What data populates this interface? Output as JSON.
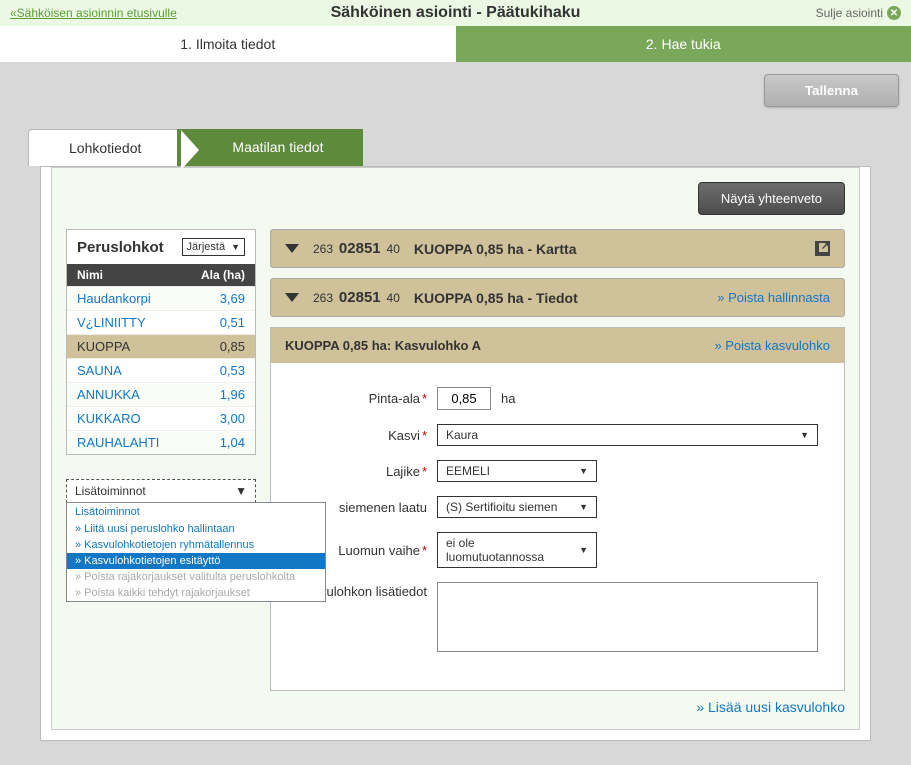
{
  "topbar": {
    "home_link": "«Sähköisen asioinnin etusivulle",
    "title": "Sähköinen asiointi  -  Päätukihaku",
    "close": "Sulje asiointi"
  },
  "steps": {
    "step1": "1. Ilmoita tiedot",
    "step2": "2. Hae tukia"
  },
  "toolbar": {
    "save": "Tallenna"
  },
  "tabs": {
    "tab1": "Lohkotiedot",
    "tab2": "Maatilan tiedot"
  },
  "summary_btn": "Näytä yhteenveto",
  "sidebar": {
    "title": "Peruslohkot",
    "sort_label": "Järjestä",
    "col_name": "Nimi",
    "col_area": "Ala (ha)",
    "rows": [
      {
        "name": "Haudankorpi",
        "area": "3,69"
      },
      {
        "name": "V¿LINIITTY",
        "area": "0,51"
      },
      {
        "name": "KUOPPA",
        "area": "0,85"
      },
      {
        "name": "SAUNA",
        "area": "0,53"
      },
      {
        "name": "ANNUKKA",
        "area": "1,96"
      },
      {
        "name": "KUKKARO",
        "area": "3,00"
      },
      {
        "name": "RAUHALAHTI",
        "area": "1,04"
      }
    ],
    "actions_label": "Lisätoiminnot",
    "menu": {
      "heading": "Lisätoiminnot",
      "items": [
        "» Liitä uusi peruslohko hallintaan",
        "» Kasvulohkotietojen ryhmätallennus",
        "» Kasvulohkotietojen esitäyttö",
        "» Poista rajakorjaukset valitulta peruslohkolta",
        "» Poista kaikki tehdyt rajakorjaukset"
      ]
    }
  },
  "block1": {
    "id_s1": "263",
    "id_b": "02851",
    "id_s2": "40",
    "title": "KUOPPA 0,85 ha - Kartta"
  },
  "block2": {
    "id_s1": "263",
    "id_b": "02851",
    "id_s2": "40",
    "title": "KUOPPA 0,85 ha - Tiedot",
    "link": "» Poista hallinnasta"
  },
  "growth": {
    "title": "KUOPPA 0,85 ha: Kasvulohko A",
    "remove": "» Poista kasvulohko"
  },
  "form": {
    "area_label": "Pinta-ala",
    "area_value": "0,85",
    "area_unit": "ha",
    "plant_label": "Kasvi",
    "plant_value": "Kaura",
    "variety_label": "Lajike",
    "variety_value": "EEMELI",
    "seed_label": "siemenen laatu",
    "seed_value": "(S) Sertifioitu siemen",
    "organic_label": "Luomun vaihe",
    "organic_value": "ei ole luomutuotannossa",
    "notes_label": "Kasvulohkon lisätiedot",
    "notes_value": ""
  },
  "add_growth": "» Lisää uusi kasvulohko"
}
